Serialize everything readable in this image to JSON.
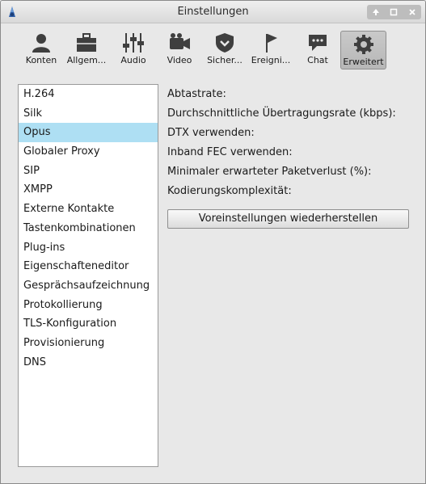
{
  "window": {
    "title": "Einstellungen"
  },
  "toolbar": {
    "items": [
      {
        "label": "Konten",
        "icon": "user-icon"
      },
      {
        "label": "Allgem...",
        "icon": "briefcase-icon"
      },
      {
        "label": "Audio",
        "icon": "sliders-icon"
      },
      {
        "label": "Video",
        "icon": "camera-icon"
      },
      {
        "label": "Sicher...",
        "icon": "shield-icon"
      },
      {
        "label": "Ereigni...",
        "icon": "flag-icon"
      },
      {
        "label": "Chat",
        "icon": "chat-icon"
      },
      {
        "label": "Erweitert",
        "icon": "gear-icon",
        "active": true
      }
    ]
  },
  "sidebar": {
    "items": [
      {
        "label": "H.264"
      },
      {
        "label": "Silk"
      },
      {
        "label": "Opus",
        "selected": true
      },
      {
        "label": "Globaler Proxy"
      },
      {
        "label": "SIP"
      },
      {
        "label": "XMPP"
      },
      {
        "label": "Externe Kontakte"
      },
      {
        "label": "Tastenkombinationen"
      },
      {
        "label": "Plug-ins"
      },
      {
        "label": "Eigenschafteneditor"
      },
      {
        "label": "Gesprächsaufzeichnung"
      },
      {
        "label": "Protokollierung"
      },
      {
        "label": "TLS-Konfiguration"
      },
      {
        "label": "Provisionierung"
      },
      {
        "label": "DNS"
      }
    ]
  },
  "opus": {
    "settings": [
      {
        "label": "Abtastrate:"
      },
      {
        "label": "Durchschnittliche Übertragungsrate (kbps):"
      },
      {
        "label": "DTX verwenden:"
      },
      {
        "label": "Inband FEC verwenden:"
      },
      {
        "label": "Minimaler erwarteter Paketverlust (%):"
      },
      {
        "label": "Kodierungskomplexität:"
      }
    ],
    "reset_label": "Voreinstellungen wiederherstellen"
  },
  "colors": {
    "selection": "#aedff3",
    "active_toolbar": "#bdbdbd"
  }
}
